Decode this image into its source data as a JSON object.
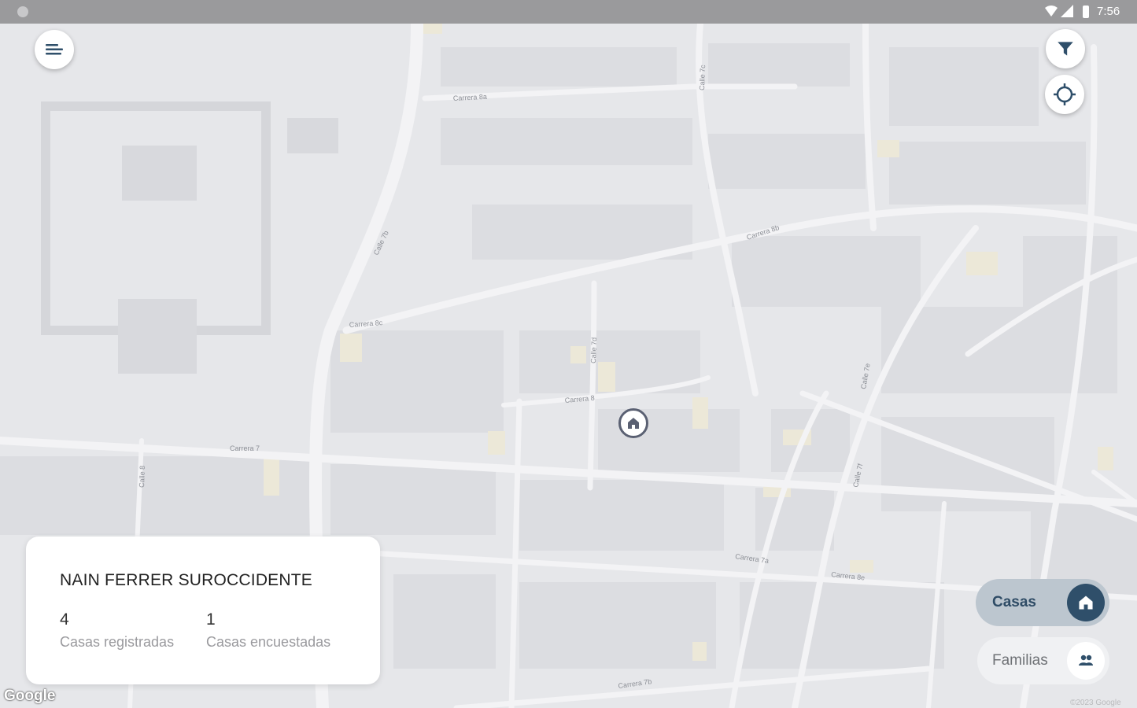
{
  "status_bar": {
    "time": "7:56"
  },
  "map": {
    "street_labels": [
      "Carrera 8a",
      "Carrera 8b",
      "Carrera 8c",
      "Carrera 8",
      "Calle 7b",
      "Calle 7c",
      "Carrera 7",
      "Carrera 7a",
      "Carrera 8e",
      "Calle 7d",
      "Calle 7e",
      "Calle 7f",
      "Carrera 7b",
      "Calle 8"
    ],
    "google_logo": "Google",
    "copyright": "©2023 Google"
  },
  "buttons": {
    "menu_icon": "menu-icon",
    "filter_icon": "filter-icon",
    "locate_icon": "crosshair-icon"
  },
  "marker": {
    "icon": "house-icon"
  },
  "info_card": {
    "title": "NAIN FERRER SUROCCIDENTE",
    "stats": [
      {
        "value": "4",
        "label": "Casas registradas"
      },
      {
        "value": "1",
        "label": "Casas encuestadas"
      }
    ]
  },
  "toggles": {
    "casas": {
      "label": "Casas",
      "icon": "house-icon"
    },
    "familias": {
      "label": "Familias",
      "icon": "people-icon"
    }
  },
  "colors": {
    "accent": "#2f4f6a",
    "accent_light": "#bcc6cf",
    "map_bg": "#e6e7ea"
  }
}
